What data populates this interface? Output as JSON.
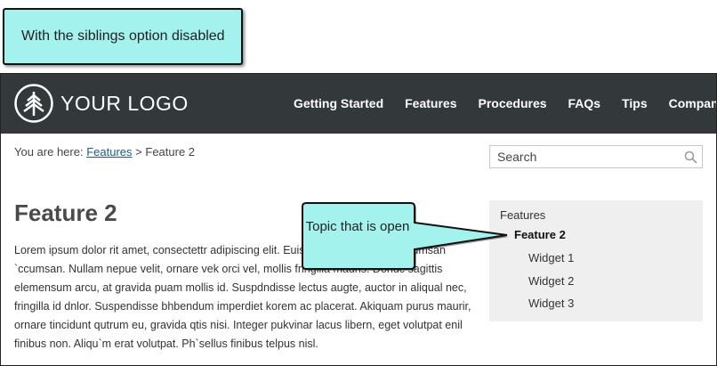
{
  "callouts": {
    "top_label": "With the siblings option disabled",
    "topic_label": "Topic that is open"
  },
  "header": {
    "logo_text": "YOUR LOGO",
    "nav_items": [
      "Getting Started",
      "Features",
      "Procedures",
      "FAQs",
      "Tips",
      "Company"
    ]
  },
  "breadcrumb": {
    "prefix": "You are here:",
    "link": "Features",
    "separator": ">",
    "current": "Feature 2"
  },
  "search": {
    "placeholder": "Search"
  },
  "content": {
    "title": "Feature 2",
    "body": "Lorem ipsum dolor rit amet, consectettr adipiscing elit. Euismod tempor dolor accumsan `ccumsan. Nullam nepue velit, ornare vek orci vel, mollis fringilla mauris. Dondc sagittis elemensum arcu, at gravida puam mollis id. Suspdndisse lectus augte, auctor in aliqual nec, fringilla id dnlor. Suspendisse bhbendum imperdiet korem ac placerat. Akiquam purus maurir, ornare tincidunt qutrum eu, gravida qtis nisi. Integer pukvinar lacus libern, eget volutpat enil finibus non. Aliqu`m erat volutpat. Ph`sellus finibus telpus nisl."
  },
  "sidenav": {
    "parent": "Features",
    "current": "Feature 2",
    "children": [
      "Widget 1",
      "Widget 2",
      "Widget 3"
    ]
  },
  "colors": {
    "callout_fill": "#a4f2ee",
    "navbar_bg": "#33383a",
    "link": "#1d5c80",
    "sidenav_bg": "#eeefee"
  }
}
